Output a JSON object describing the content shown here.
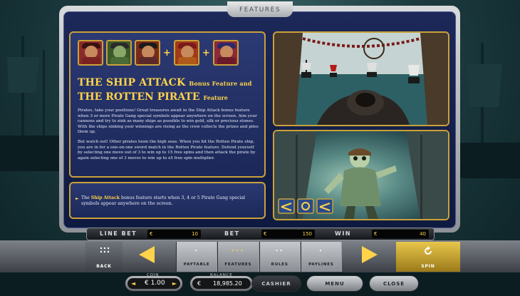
{
  "header": {
    "tab_title": "FEATURES"
  },
  "feature": {
    "title_line1": "THE SHIP ATTACK",
    "title_line1_small": "Bonus Feature and",
    "title_line2": "THE ROTTEN PIRATE",
    "title_line2_small": "Feature",
    "paragraph1": "Pirates, take your positions! Great treasures await in the Ship Attack bonus feature when 3 or more Pirate Gang special symbols appear anywhere on the screen. Aim your cannons and try to sink as many ships as possible to win gold, silk or precious stones. With the ships sinking your winnings are rising as the crew collects the prizes and piles them up.",
    "paragraph2": "But watch out! Other pirates loom the high seas. When you hit the Rotten Pirate ship, you are in for a one-on-one sword match in the Rotten Pirate feature. Defend yourself by selecting one move out of 3 to win up to 15 free spins and then attack the pirate by again selecting one of 3 moves to win up to x5 free spin multiplier.",
    "note_prefix": "The ",
    "note_highlight": "Ship Attack",
    "note_suffix": " bonus feature starts when 3, 4 or 5 Pirate Gang special symbols appear anywhere on the screen."
  },
  "symbols": [
    "pirate-symbol-1",
    "pirate-symbol-2",
    "pirate-symbol-3",
    "pirate-symbol-4",
    "pirate-symbol-5"
  ],
  "plus_sign": "+",
  "bet_bar": {
    "line_bet_label": "LINE BET",
    "line_bet_currency": "€",
    "line_bet_value": "10",
    "bet_label": "BET",
    "bet_currency": "€",
    "bet_value": "150",
    "win_label": "WIN",
    "win_currency": "€",
    "win_value": "40"
  },
  "nav": {
    "back_label": "BACK",
    "spin_label": "SPIN",
    "tabs": [
      {
        "label": "PAYTABLE",
        "dots": "•"
      },
      {
        "label": "FEATURES",
        "dots": "•••"
      },
      {
        "label": "RULES",
        "dots": "••"
      },
      {
        "label": "PAYLINES",
        "dots": "•"
      }
    ]
  },
  "footer": {
    "coin_label": "COIN",
    "coin_value": "€ 1.00",
    "balance_label": "BALANCE",
    "balance_currency": "€",
    "balance_value": "18,985.20",
    "cashier_label": "CASHIER",
    "menu_label": "MENU",
    "close_label": "CLOSE"
  },
  "colors": {
    "accent": "#ffd34a",
    "panel_bg": "#1c2858",
    "spin": "#e8c64c"
  }
}
